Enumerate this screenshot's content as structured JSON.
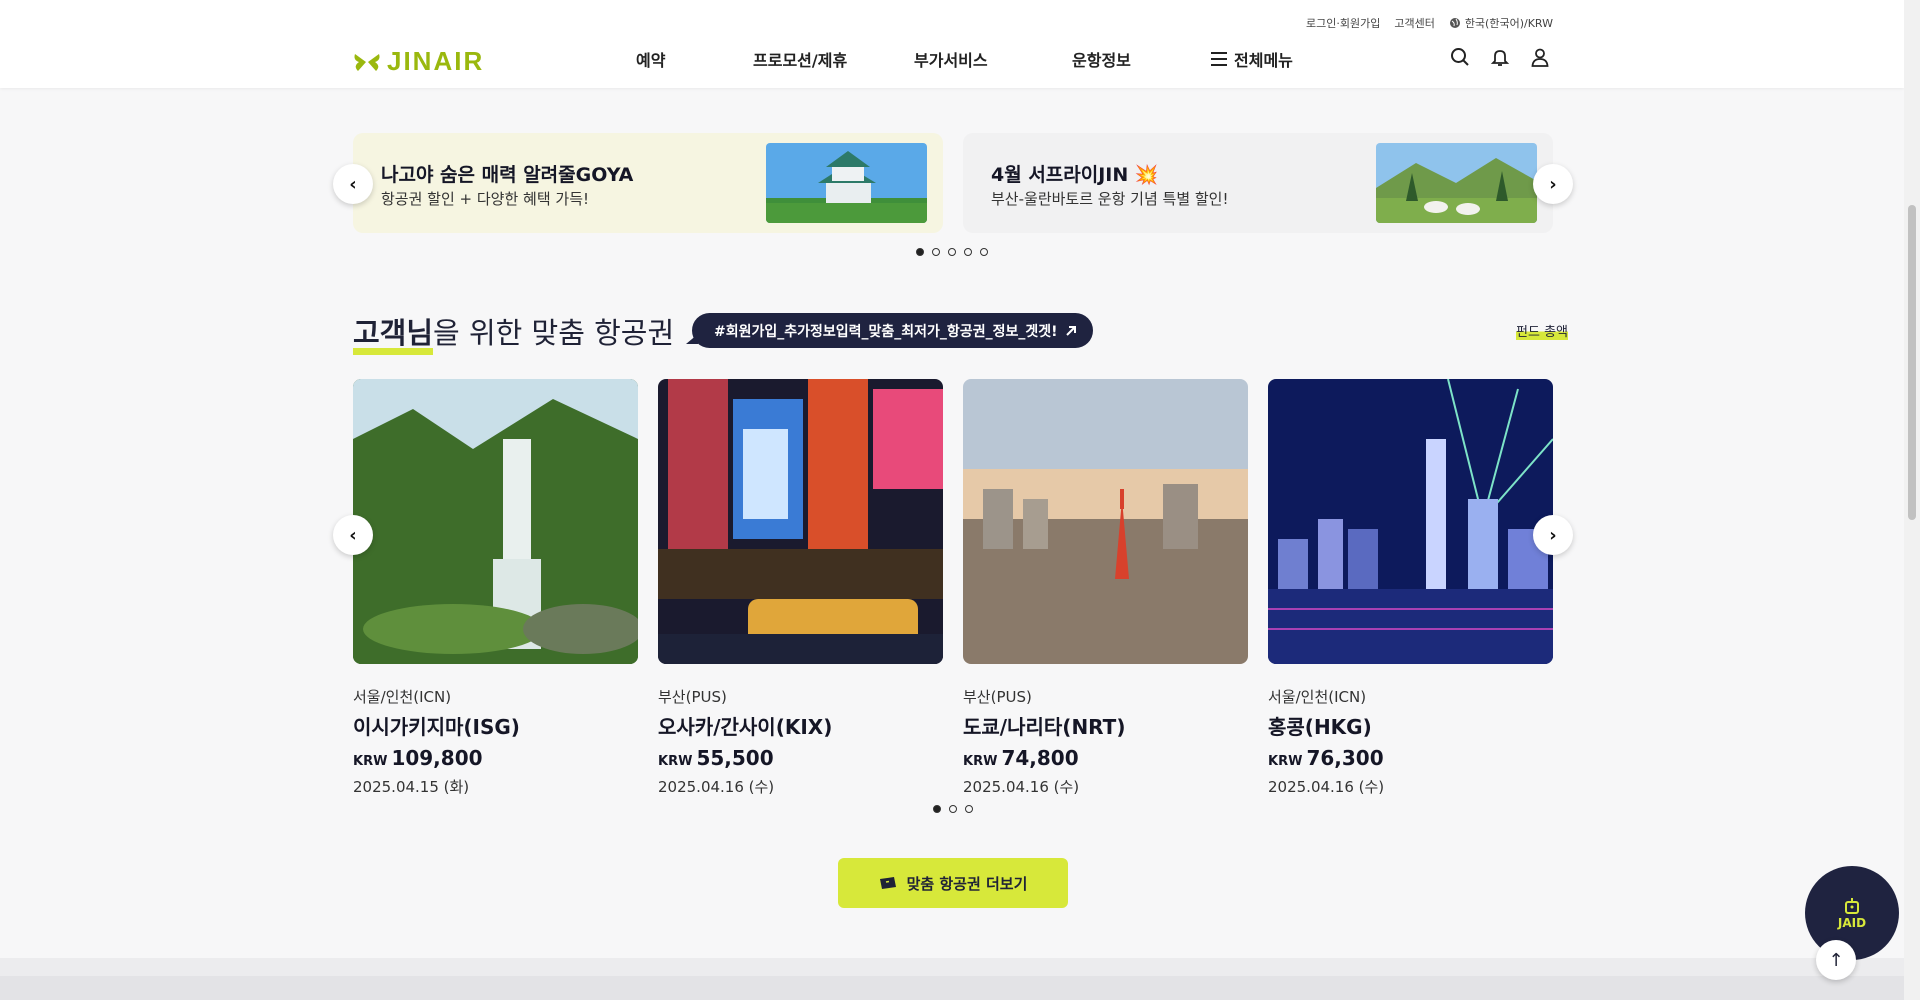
{
  "util": {
    "login": "로그인·회원가입",
    "support": "고객센터",
    "lang": "한국(한국어)/KRW"
  },
  "logo": {
    "text": "JINAIR"
  },
  "nav": [
    "예약",
    "프로모션/제휴",
    "부가서비스",
    "운항정보",
    "전체메뉴"
  ],
  "promos": [
    {
      "title": "나고야 숨은 매력 알려줄GOYA",
      "sub": "항공권 할인 + 다양한 혜택 가득!"
    },
    {
      "title": "4월 서프라이JIN 💥",
      "sub": "부산-울란바토르 운항 기념 특별 할인!"
    }
  ],
  "section": {
    "title_bold": "고객님",
    "title_rest": "을 위한 맞춤 항공권",
    "tag": "#회원가입_추가정보입력_맞춤_최저가_항공권_정보_겟겟!",
    "fund": "펀드 총액"
  },
  "cards": [
    {
      "dep": "서울/인천(ICN)",
      "dest": "이시가키지마(ISG)",
      "currency": "KRW",
      "price": "109,800",
      "date": "2025.04.15 (화)"
    },
    {
      "dep": "부산(PUS)",
      "dest": "오사카/간사이(KIX)",
      "currency": "KRW",
      "price": "55,500",
      "date": "2025.04.16 (수)"
    },
    {
      "dep": "부산(PUS)",
      "dest": "도쿄/나리타(NRT)",
      "currency": "KRW",
      "price": "74,800",
      "date": "2025.04.16 (수)"
    },
    {
      "dep": "서울/인천(ICN)",
      "dest": "홍콩(HKG)",
      "currency": "KRW",
      "price": "76,300",
      "date": "2025.04.16 (수)"
    }
  ],
  "more_button": "맞춤 항공권 더보기",
  "jaid": "JAID",
  "colors": {
    "accent": "#d7e83a",
    "navy": "#1f2340",
    "logo": "#9ab80e"
  }
}
